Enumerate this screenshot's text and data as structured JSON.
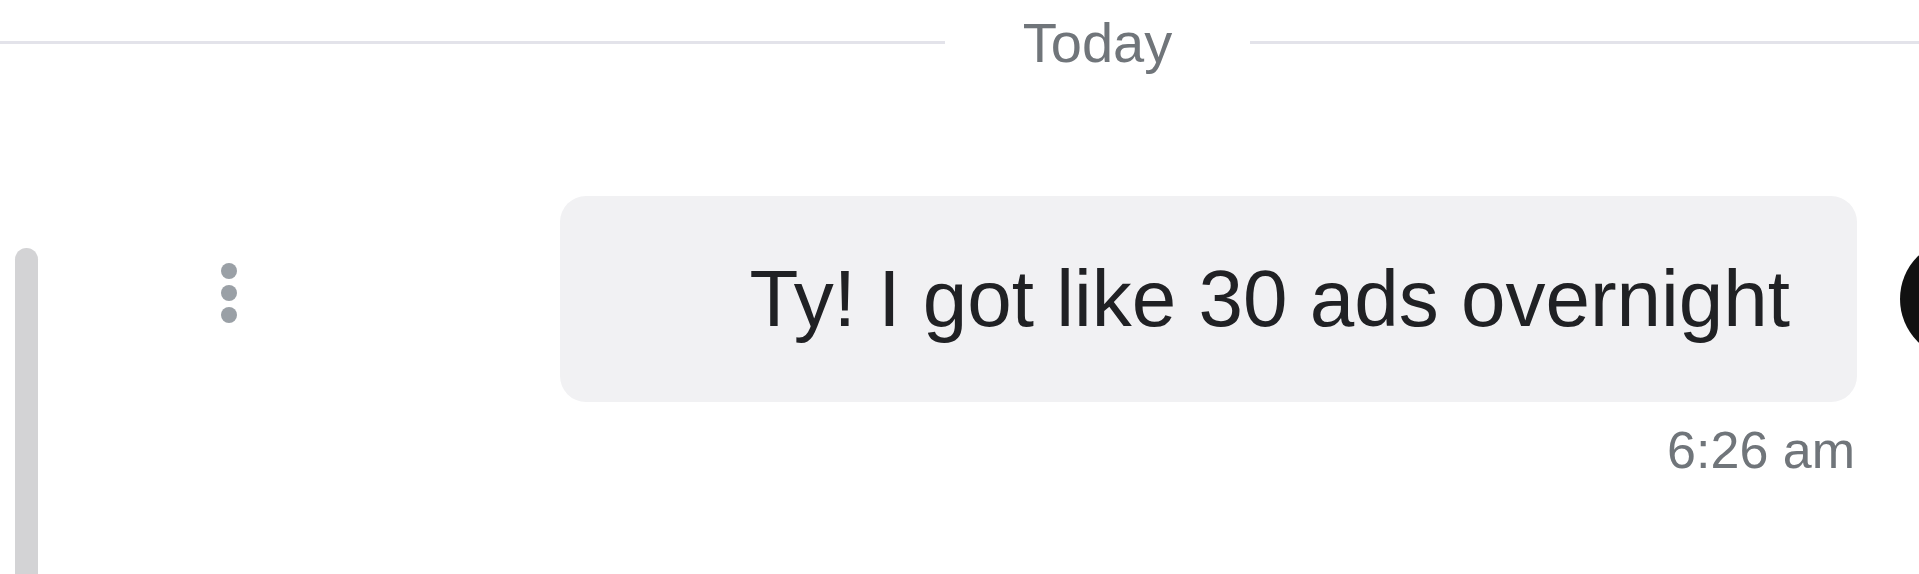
{
  "date_divider": {
    "label": "Today"
  },
  "messages": [
    {
      "text": "Ty! I got like 30 ads overnight",
      "time": "6:26 am"
    }
  ]
}
